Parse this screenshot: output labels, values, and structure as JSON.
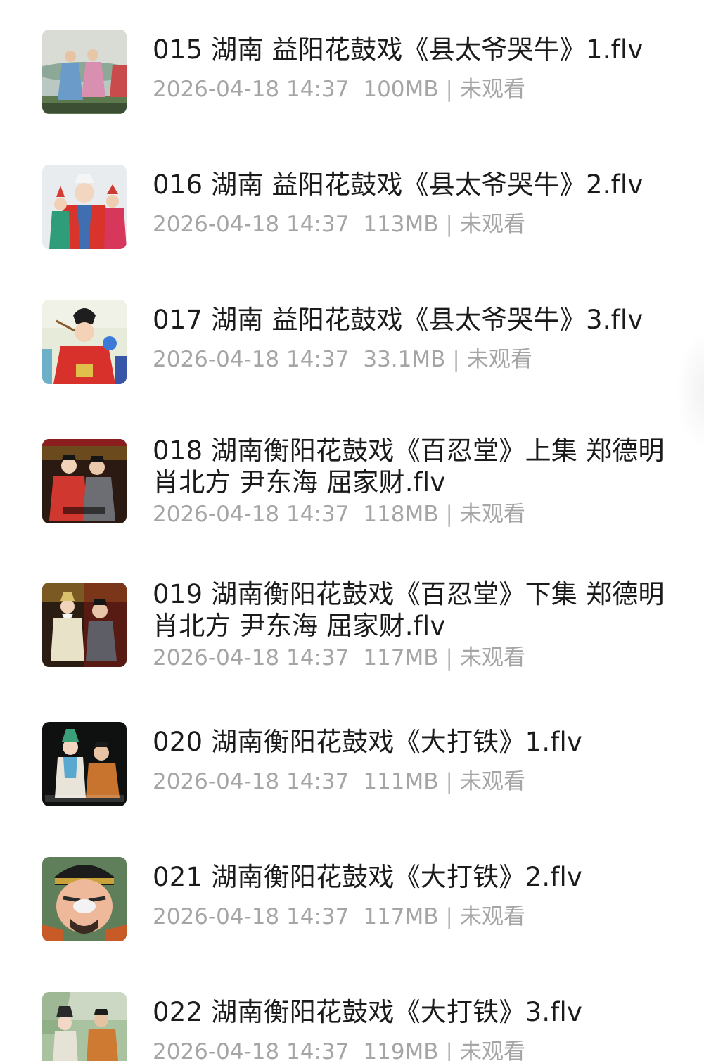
{
  "files": [
    {
      "title": "015 湖南 益阳花鼓戏《县太爷哭牛》1.flv",
      "date": "2026-04-18 14:37",
      "size": "100MB",
      "status": "未观看"
    },
    {
      "title": "016 湖南 益阳花鼓戏《县太爷哭牛》2.flv",
      "date": "2026-04-18 14:37",
      "size": "113MB",
      "status": "未观看"
    },
    {
      "title": "017 湖南 益阳花鼓戏《县太爷哭牛》3.flv",
      "date": "2026-04-18 14:37",
      "size": "33.1MB",
      "status": "未观看"
    },
    {
      "title": "018 湖南衡阳花鼓戏《百忍堂》上集 郑德明 肖北方 尹东海 屈家财.flv",
      "date": "2026-04-18 14:37",
      "size": "118MB",
      "status": "未观看"
    },
    {
      "title": "019 湖南衡阳花鼓戏《百忍堂》下集 郑德明 肖北方 尹东海 屈家财.flv",
      "date": "2026-04-18 14:37",
      "size": "117MB",
      "status": "未观看"
    },
    {
      "title": "020 湖南衡阳花鼓戏《大打铁》1.flv",
      "date": "2026-04-18 14:37",
      "size": "111MB",
      "status": "未观看"
    },
    {
      "title": "021 湖南衡阳花鼓戏《大打铁》2.flv",
      "date": "2026-04-18 14:37",
      "size": "117MB",
      "status": "未观看"
    },
    {
      "title": "022 湖南衡阳花鼓戏《大打铁》3.flv",
      "date": "2026-04-18 14:37",
      "size": "119MB",
      "status": "未观看"
    }
  ],
  "separator": "|"
}
